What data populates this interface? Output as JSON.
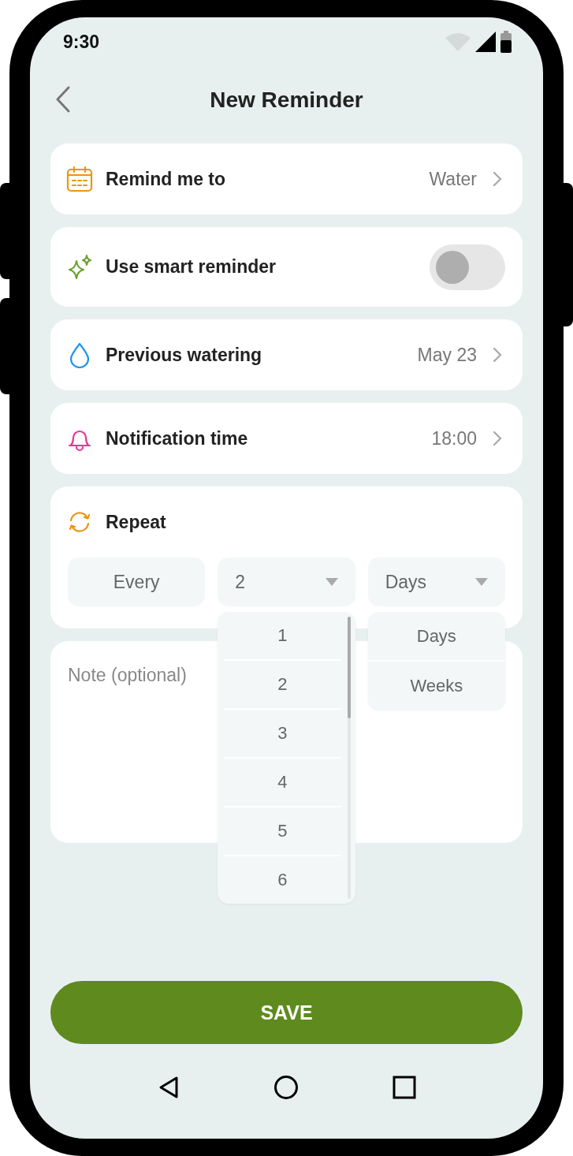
{
  "status_bar": {
    "time": "9:30"
  },
  "header": {
    "title": "New Reminder"
  },
  "settings": [
    {
      "kind": "link",
      "label": "Remind me to",
      "value": "Water"
    },
    {
      "kind": "toggle",
      "label": "Use smart reminder",
      "on": false
    },
    {
      "kind": "link",
      "label": "Previous watering",
      "value": "May 23"
    },
    {
      "kind": "link",
      "label": "Notification time",
      "value": "18:00"
    }
  ],
  "repeat": {
    "label": "Repeat",
    "prefix": "Every",
    "count": {
      "value": "2",
      "options": [
        "1",
        "2",
        "3",
        "4",
        "5",
        "6"
      ]
    },
    "unit": {
      "value": "Days",
      "options": [
        "Days",
        "Weeks"
      ]
    }
  },
  "note": {
    "placeholder": "Note (optional)"
  },
  "save_button": "SAVE"
}
